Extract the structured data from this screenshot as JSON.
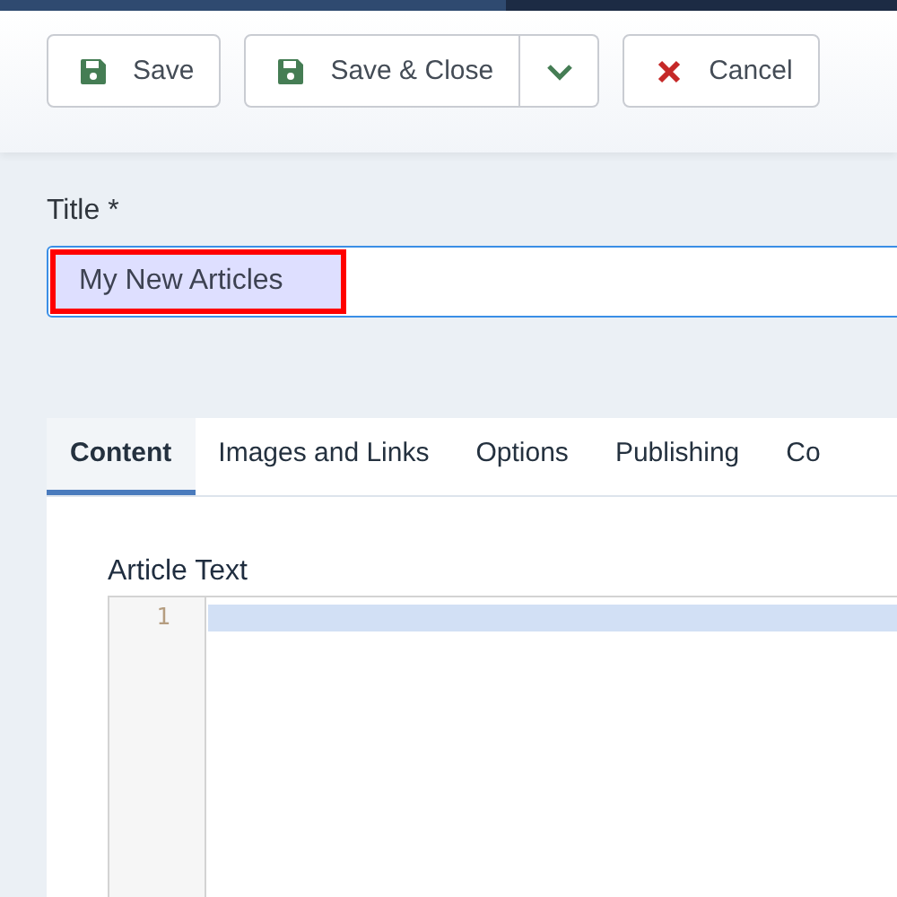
{
  "toolbar": {
    "buttons": [
      {
        "label": "Save",
        "kind": "save"
      },
      {
        "label": "Save & Close",
        "kind": "save",
        "dropdown": true
      },
      {
        "label": "Cancel",
        "kind": "cancel"
      }
    ]
  },
  "title_field": {
    "label": "Title *",
    "value": "My New Articles",
    "highlighted": true
  },
  "tabs": [
    {
      "label": "Content",
      "selected": true
    },
    {
      "label": "Images and Links",
      "selected": false
    },
    {
      "label": "Options",
      "selected": false
    },
    {
      "label": "Publishing",
      "selected": false
    },
    {
      "label": "Co",
      "selected": false
    }
  ],
  "editor": {
    "label": "Article Text",
    "line_numbers": [
      "1"
    ]
  }
}
